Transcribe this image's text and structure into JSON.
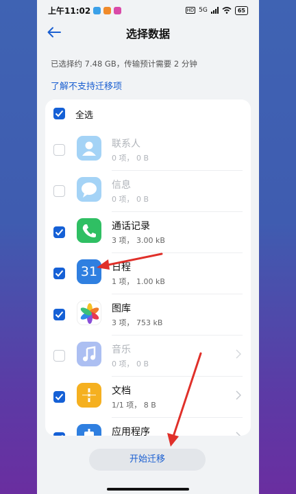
{
  "status_bar": {
    "time": "上午11:02",
    "network": "5G",
    "battery": "65"
  },
  "header": {
    "title": "选择数据"
  },
  "summary": "已选择约 7.48 GB，传输预计需要 2 分钟",
  "unsupported_link": "了解不支持迁移项",
  "select_all": {
    "label": "全选",
    "checked": true
  },
  "items": [
    {
      "title": "联系人",
      "subtitle": "0 项， 0 B",
      "checked": false,
      "enabled": false,
      "icon": "contacts-icon"
    },
    {
      "title": "信息",
      "subtitle": "0 项， 0 B",
      "checked": false,
      "enabled": false,
      "icon": "messages-icon"
    },
    {
      "title": "通话记录",
      "subtitle": "3 项， 3.00 kB",
      "checked": true,
      "enabled": true,
      "icon": "phone-icon"
    },
    {
      "title": "日程",
      "subtitle": "1 项， 1.00 kB",
      "checked": true,
      "enabled": true,
      "icon": "calendar-icon",
      "icon_text": "31"
    },
    {
      "title": "图库",
      "subtitle": "3 项， 753 kB",
      "checked": true,
      "enabled": true,
      "icon": "gallery-icon"
    },
    {
      "title": "音乐",
      "subtitle": "0 项， 0 B",
      "checked": false,
      "enabled": false,
      "icon": "music-icon"
    },
    {
      "title": "文档",
      "subtitle": "1/1 项， 8 B",
      "checked": true,
      "enabled": true,
      "icon": "documents-icon"
    },
    {
      "title": "应用程序",
      "subtitle": "",
      "checked": true,
      "enabled": true,
      "icon": "apps-icon"
    }
  ],
  "start_button": "开始迁移",
  "colors": {
    "accent": "#1560d6",
    "annotation": "#e0302a"
  }
}
